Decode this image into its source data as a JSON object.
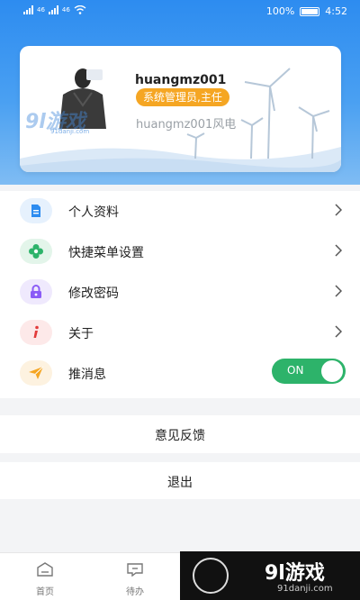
{
  "status_bar": {
    "signal_left": "46",
    "signal_right": "46",
    "battery": "100%",
    "time": "4:52"
  },
  "profile": {
    "username": "huangmz001",
    "role": "系统管理员,主任",
    "org": "huangmz001风电"
  },
  "watermark": {
    "brand": "9l游戏",
    "url": "91danji.com"
  },
  "menu": {
    "items": [
      {
        "label": "个人资料",
        "icon": "document-icon",
        "color": "#2d8cf0",
        "bg": "#e6f1fd"
      },
      {
        "label": "快捷菜单设置",
        "icon": "flower-icon",
        "color": "#2db36a",
        "bg": "#e3f5ea"
      },
      {
        "label": "修改密码",
        "icon": "lock-icon",
        "color": "#8b5cf6",
        "bg": "#efe9fd"
      },
      {
        "label": "关于",
        "icon": "info-icon",
        "color": "#e23b3b",
        "bg": "#fde9e9"
      },
      {
        "label": "推消息",
        "icon": "paper-plane-icon",
        "color": "#f5a623",
        "bg": "#fdf2e0"
      }
    ],
    "push_toggle": {
      "label": "ON",
      "on": true,
      "color": "#2db36a"
    }
  },
  "feedback_label": "意见反馈",
  "logout_label": "退出",
  "tabbar": {
    "tabs": [
      {
        "label": "首页",
        "icon": "home-icon"
      },
      {
        "label": "待办",
        "icon": "message-icon"
      }
    ]
  },
  "overlay": {
    "brand": "9l游戏",
    "url": "91danji.com"
  },
  "colors": {
    "header": "#2d8cf0",
    "badge": "#f5a623",
    "toggle": "#2db36a"
  }
}
